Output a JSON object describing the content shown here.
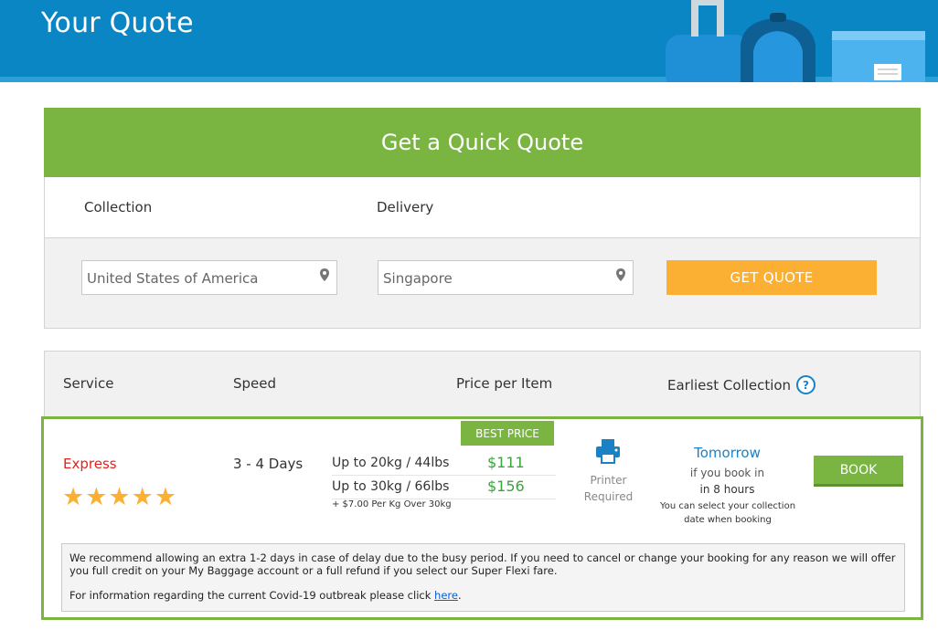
{
  "header": {
    "title": "Your Quote"
  },
  "quick_quote": {
    "title": "Get a Quick Quote",
    "collection_label": "Collection",
    "delivery_label": "Delivery",
    "collection_value": "United States of America",
    "delivery_value": "Singapore",
    "get_quote_label": "GET QUOTE"
  },
  "table": {
    "headers": {
      "service": "Service",
      "speed": "Speed",
      "price": "Price per Item",
      "earliest": "Earliest Collection"
    },
    "help_glyph": "?"
  },
  "service": {
    "name": "Express",
    "rating": 5,
    "stars": "★★★★★",
    "speed": "3 - 4 Days",
    "badge": "BEST PRICE",
    "prices": [
      {
        "weight": "Up to 20kg / 44lbs",
        "price": "$111"
      },
      {
        "weight": "Up to 30kg / 66lbs",
        "price": "$156"
      }
    ],
    "extra_note": "+ $7.00 Per Kg Over 30kg",
    "printer_line1": "Printer",
    "printer_line2": "Required",
    "collection_day": "Tomorrow",
    "book_in_text": "if you book in",
    "hours_text": "in 8 hours",
    "select_note": "You can select your collection date when booking",
    "book_label": "BOOK"
  },
  "notice": {
    "paragraph1": "We recommend allowing an extra 1-2 days in case of delay due to the busy period. If you need to cancel or change your booking for any reason we will offer you full credit on your My Baggage account or a full refund if you select our Super Flexi fare.",
    "paragraph2_prefix": "For information regarding the current Covid-19 outbreak please click ",
    "link_text": "here",
    "paragraph2_suffix": "."
  },
  "colors": {
    "header_blue": "#0b86c5",
    "green": "#7ab541",
    "orange": "#fbb034",
    "red": "#e2231a",
    "link_blue": "#1a82c4"
  }
}
